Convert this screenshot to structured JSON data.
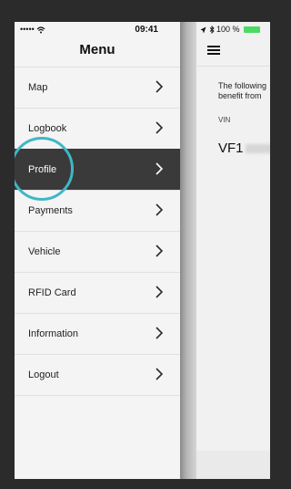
{
  "status": {
    "carrier": "•••••",
    "wifi_icon": "wifi-icon",
    "time": "09:41",
    "right_indicators": "100 %"
  },
  "menu": {
    "title": "Menu",
    "items": [
      {
        "label": "Map",
        "active": false
      },
      {
        "label": "Logbook",
        "active": false
      },
      {
        "label": "Profile",
        "active": true
      },
      {
        "label": "Payments",
        "active": false
      },
      {
        "label": "Vehicle",
        "active": false
      },
      {
        "label": "RFID Card",
        "active": false
      },
      {
        "label": "Information",
        "active": false
      },
      {
        "label": "Logout",
        "active": false
      }
    ]
  },
  "content": {
    "text_line1": "The following",
    "text_line2": "benefit from",
    "vin_label": "VIN",
    "vin_value": "VF1"
  },
  "colors": {
    "active_item_bg": "#3a3a3a",
    "highlight_ring": "#3fb7c6",
    "battery": "#4cd964"
  }
}
